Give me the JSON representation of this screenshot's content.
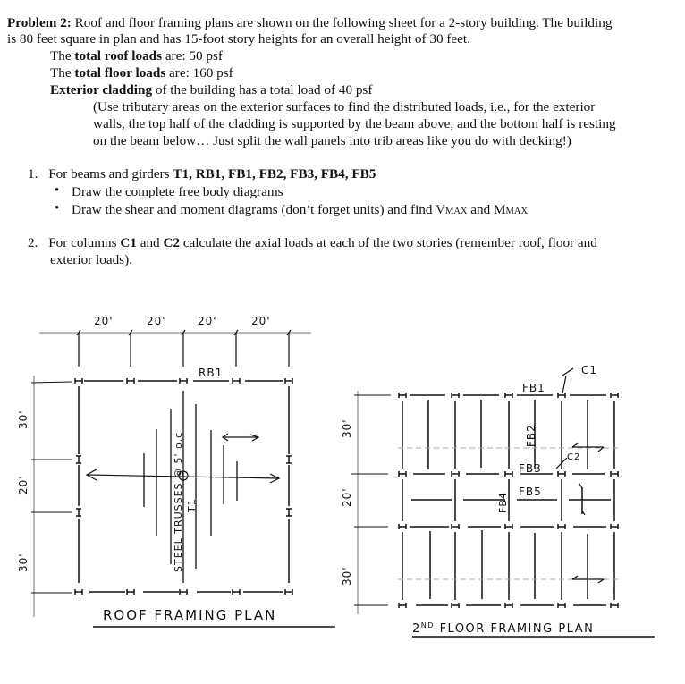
{
  "problem": {
    "heading": "Problem 2:",
    "intro_line1": " Roof and floor framing plans are shown on the following sheet for a 2-story building. The building",
    "intro_line2": "is 80 feet square in plan and has 15-foot story heights for an overall height of 30 feet.",
    "roof_prefix": "The ",
    "roof_bold": "total roof loads",
    "roof_suffix": " are: 50 psf",
    "floor_prefix": "The ",
    "floor_bold": "total floor loads",
    "floor_suffix": " are: 160 psf",
    "clad_bold": "Exterior cladding",
    "clad_suffix": " of the building has a total load of 40 psf",
    "note_line1": "(Use tributary areas on the exterior surfaces to find the distributed loads, i.e., for the exterior",
    "note_line2": "walls, the top half of the cladding is supported by the beam above, and the bottom half is resting",
    "note_line3": "on the beam below…  Just split the wall panels into trib areas like you do with decking!)"
  },
  "tasks": [
    {
      "number": "1.",
      "prefix": "For beams and girders ",
      "bold": "T1, RB1, FB1, FB2, FB3, FB4, FB5",
      "bullets": [
        "Draw the complete free body diagrams",
        "Draw the shear and moment diagrams (don’t forget units) and find V"
      ],
      "vmax_sub": "MAX",
      "and_text": " and M",
      "mmax_sub": "MAX"
    },
    {
      "number": "2.",
      "prefix": "For columns ",
      "bold1": "C1",
      "mid": " and ",
      "bold2": "C2",
      "suffix": " calculate the axial loads at each of the two stories (remember roof, floor and",
      "line2": "exterior loads)."
    }
  ],
  "roof_plan": {
    "title": "ROOF FRAMING PLAN",
    "top_dims": [
      "20'",
      "20'",
      "20'",
      "20'"
    ],
    "side_dims": [
      "30'",
      "20'",
      "30'"
    ],
    "beam_label": "RB1",
    "truss_label": "STEEL TRUSSES @ 5' o.c",
    "truss_id": "T1"
  },
  "floor_plan": {
    "title": "2ND FLOOR FRAMING PLAN",
    "title_sup": "ND",
    "title_pre": "2",
    "title_rest": " FLOOR FRAMING PLAN",
    "side_dims": [
      "30'",
      "20'",
      "30'"
    ],
    "labels": {
      "fb1": "FB1",
      "fb2": "FB2",
      "fb3": "FB3",
      "fb4": "FB4",
      "fb5": "FB5",
      "c1": "C1",
      "c2": "C2"
    }
  }
}
